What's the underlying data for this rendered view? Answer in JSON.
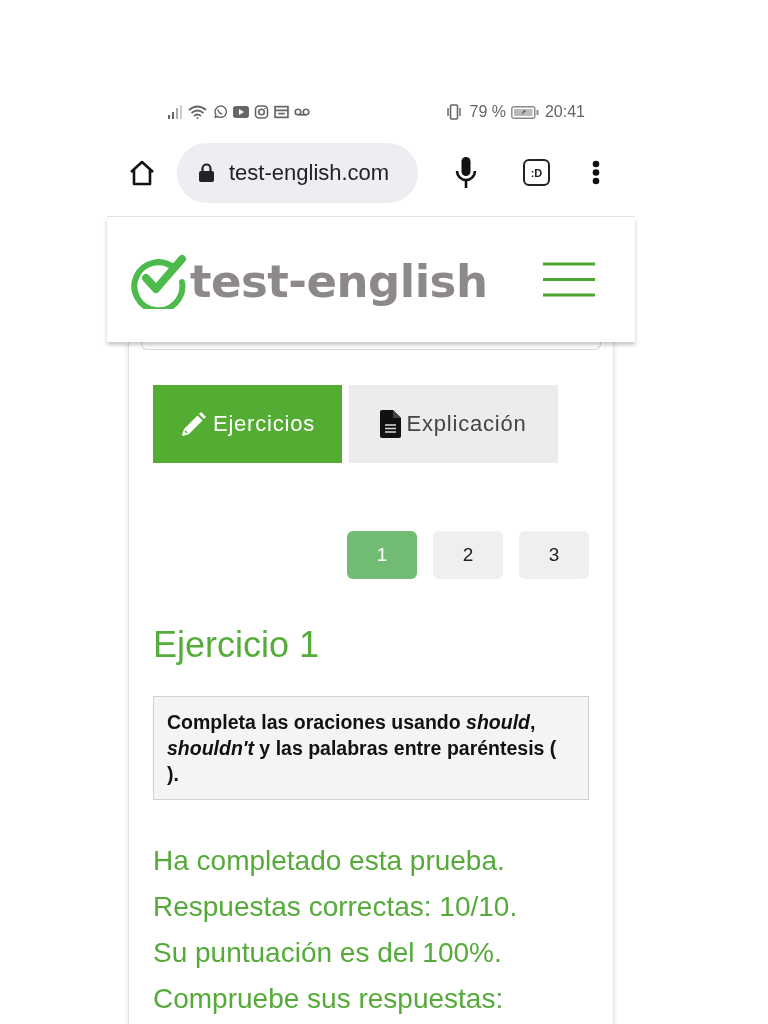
{
  "status_bar": {
    "battery": "79 %",
    "time": "20:41"
  },
  "browser": {
    "url": "test-english.com",
    "tab_switcher": ":D"
  },
  "site_header": {
    "logo_text": "test-english"
  },
  "tabs": [
    {
      "label": "Ejercicios",
      "selected": true
    },
    {
      "label": "Explicación",
      "selected": false
    }
  ],
  "pagination": [
    {
      "label": "1",
      "selected": true
    },
    {
      "label": "2",
      "selected": false
    },
    {
      "label": "3",
      "selected": false
    }
  ],
  "exercise": {
    "title": "Ejercicio 1",
    "instructions": "Completa las oraciones usando *should*, *shouldn't* y las palabras entre paréntesis ( )."
  },
  "result": {
    "lines": [
      "Ha completado esta prueba.",
      "Respuestas correctas: 10/10.",
      "Su puntuación es del 100%.",
      "Compruebe sus respuestas:"
    ]
  }
}
